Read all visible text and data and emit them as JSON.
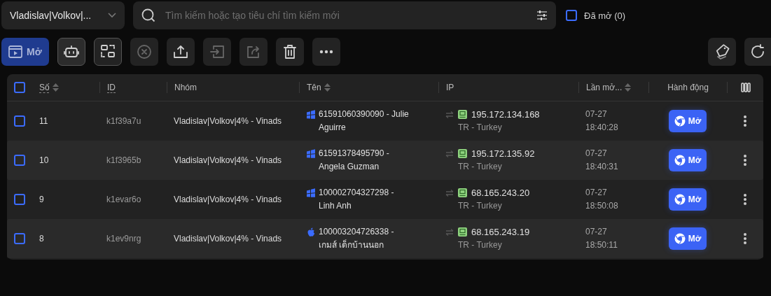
{
  "group_select": {
    "value": "Vladislav|Volkov|..."
  },
  "search": {
    "placeholder": "Tìm kiếm hoặc tạo tiêu chí tìm kiếm mới"
  },
  "opened_filter": {
    "label": "Đã mở (0)",
    "checked": false
  },
  "toolbar": [
    {
      "kind": "open",
      "label": "Mở",
      "disabled": false
    },
    {
      "kind": "robot",
      "disabled": false
    },
    {
      "kind": "arrange",
      "disabled": false
    },
    {
      "kind": "close",
      "disabled": true
    },
    {
      "kind": "upload",
      "disabled": false
    },
    {
      "kind": "import",
      "disabled": true
    },
    {
      "kind": "share",
      "disabled": true
    },
    {
      "kind": "delete",
      "disabled": false
    },
    {
      "kind": "more",
      "disabled": false
    }
  ],
  "toolbar_right": [
    {
      "kind": "tag"
    },
    {
      "kind": "refresh"
    }
  ],
  "table": {
    "select_all": {
      "checked": false
    },
    "columns": [
      {
        "label": "Số",
        "sortable": true,
        "underlined": true
      },
      {
        "label": "ID",
        "sortable": false,
        "underlined": true
      },
      {
        "label": "Nhóm",
        "sortable": false,
        "underlined": false
      },
      {
        "label": "Tên",
        "sortable": true,
        "underlined": false
      },
      {
        "label": "IP",
        "sortable": false,
        "underlined": false
      },
      {
        "label": "Lần mở...",
        "sortable": true,
        "underlined": false
      },
      {
        "label": "Hành động",
        "sortable": false,
        "underlined": false
      }
    ],
    "rows": [
      {
        "checked": false,
        "number": "11",
        "id": "k1f39a7u",
        "group": "Vladislav|Volkov|4% - Vinads",
        "kind": "windows",
        "name": [
          "61591060390090 - Julie",
          "Aguirre"
        ],
        "ip": "195.172.134.168",
        "location": "TR - Turkey",
        "opened": [
          "07-27",
          "18:40:28"
        ],
        "action": "Mở"
      },
      {
        "checked": false,
        "number": "10",
        "id": "k1f3965b",
        "group": "Vladislav|Volkov|4% - Vinads",
        "kind": "windows",
        "name": [
          "61591378495790 -",
          "Angela Guzman"
        ],
        "ip": "195.172.135.92",
        "location": "TR - Turkey",
        "opened": [
          "07-27",
          "18:40:31"
        ],
        "action": "Mở"
      },
      {
        "checked": false,
        "number": "9",
        "id": "k1evar6o",
        "group": "Vladislav|Volkov|4% - Vinads",
        "kind": "windows",
        "name": [
          "100002704327298 -",
          "Linh Anh"
        ],
        "ip": "68.165.243.20",
        "location": "TR - Turkey",
        "opened": [
          "07-27",
          "18:50:08"
        ],
        "action": "Mở"
      },
      {
        "checked": false,
        "number": "8",
        "id": "k1ev9nrg",
        "group": "Vladislav|Volkov|4% - Vinads",
        "kind": "apple",
        "name": [
          "100003204726338 -",
          "เกมส์ เด็กบ้านนอก"
        ],
        "ip": "68.165.243.19",
        "location": "TR - Turkey",
        "opened": [
          "07-27",
          "18:50:11"
        ],
        "action": "Mở"
      }
    ]
  }
}
